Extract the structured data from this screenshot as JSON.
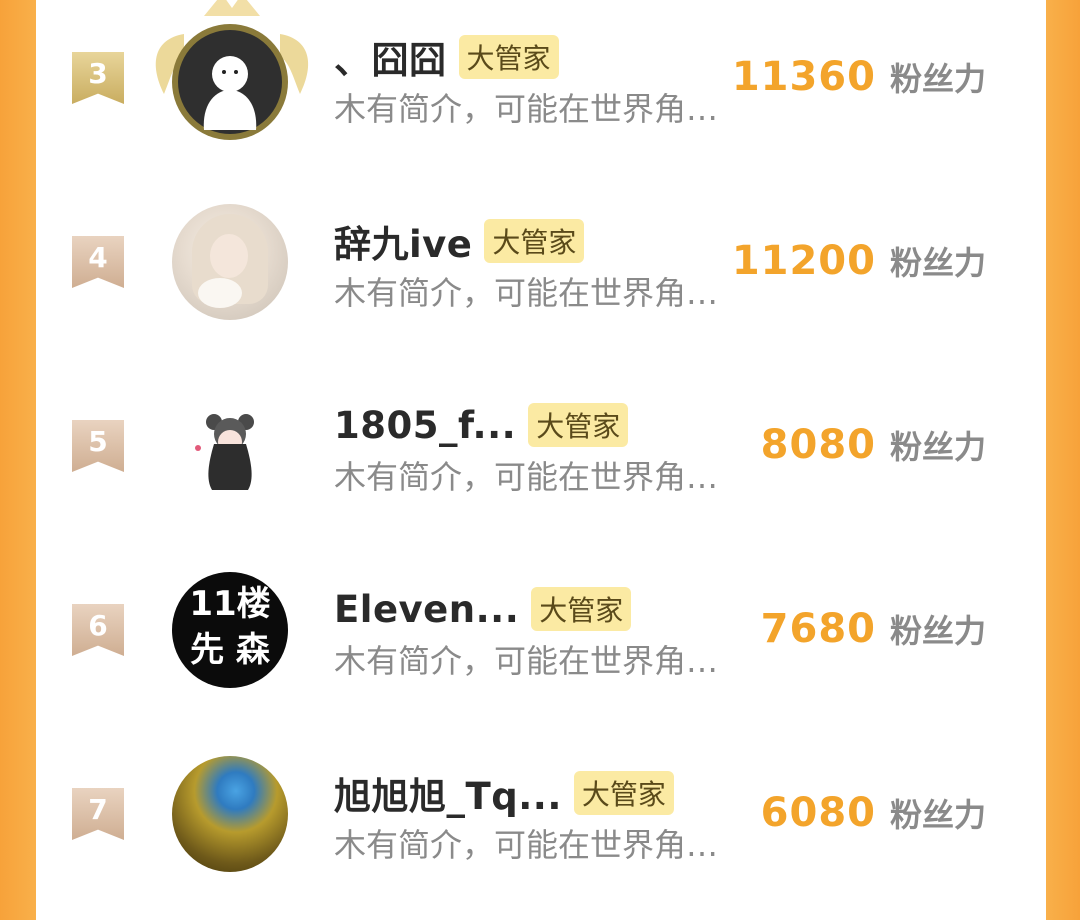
{
  "entries": [
    {
      "rank": "3",
      "name": "、囧囧",
      "badge": "大管家",
      "bio": "木有简介，可能在世界角…",
      "score": "11360",
      "unit": "粉丝力"
    },
    {
      "rank": "4",
      "name": "辞九ive",
      "badge": "大管家",
      "bio": "木有简介，可能在世界角…",
      "score": "11200",
      "unit": "粉丝力"
    },
    {
      "rank": "5",
      "name": "1805_f...",
      "badge": "大管家",
      "bio": "木有简介，可能在世界角…",
      "score": "8080",
      "unit": "粉丝力"
    },
    {
      "rank": "6",
      "name": "Eleven...",
      "badge": "大管家",
      "bio": "木有简介，可能在世界角…",
      "score": "7680",
      "unit": "粉丝力",
      "avatar_text_1": "11楼",
      "avatar_text_2": "先 森"
    },
    {
      "rank": "7",
      "name": "旭旭旭_Tq...",
      "badge": "大管家",
      "bio": "木有简介，可能在世界角…",
      "score": "6080",
      "unit": "粉丝力"
    }
  ],
  "colors": {
    "accent": "#f3a42b",
    "border": "#f7a23a",
    "badge_bg": "#fbeaa3"
  },
  "icons": [
    "rank-ribbon-icon",
    "crown-wings-icon"
  ]
}
